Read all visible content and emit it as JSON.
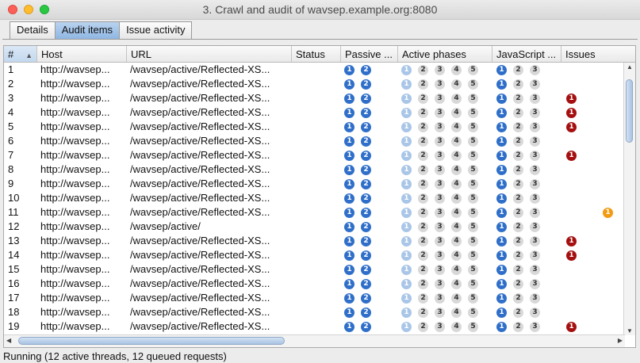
{
  "window": {
    "title": "3. Crawl and audit of wavsep.example.org:8080"
  },
  "tabs": [
    {
      "label": "Details",
      "active": false
    },
    {
      "label": "Audit items",
      "active": true
    },
    {
      "label": "Issue activity",
      "active": false
    }
  ],
  "columns": {
    "num": "#",
    "host": "Host",
    "url": "URL",
    "status": "Status",
    "passive": "Passive ...",
    "active": "Active phases",
    "js": "JavaScript ...",
    "issues": "Issues"
  },
  "phase_labels": {
    "passive": [
      "1",
      "2"
    ],
    "active": [
      "1",
      "2",
      "3",
      "4",
      "5"
    ],
    "js": [
      "1",
      "2",
      "3"
    ]
  },
  "colors": {
    "complete_blue": "#2f6fc9",
    "light_blue": "#a9c6e8",
    "pending_gray": "#d8d8d8",
    "issue_high_red": "#a50f0f",
    "issue_medium_orange": "#f29a12"
  },
  "rows": [
    {
      "num": "1",
      "host": "http://wavsep...",
      "url": "/wavsep/active/Reflected-XS...",
      "status": "",
      "passive_done": 2,
      "active_done": 1,
      "js_done": 1,
      "issue_high": "",
      "issue_medium": ""
    },
    {
      "num": "2",
      "host": "http://wavsep...",
      "url": "/wavsep/active/Reflected-XS...",
      "status": "",
      "passive_done": 2,
      "active_done": 1,
      "js_done": 1,
      "issue_high": "",
      "issue_medium": ""
    },
    {
      "num": "3",
      "host": "http://wavsep...",
      "url": "/wavsep/active/Reflected-XS...",
      "status": "",
      "passive_done": 2,
      "active_done": 1,
      "js_done": 1,
      "issue_high": "1",
      "issue_medium": ""
    },
    {
      "num": "4",
      "host": "http://wavsep...",
      "url": "/wavsep/active/Reflected-XS...",
      "status": "",
      "passive_done": 2,
      "active_done": 1,
      "js_done": 1,
      "issue_high": "1",
      "issue_medium": ""
    },
    {
      "num": "5",
      "host": "http://wavsep...",
      "url": "/wavsep/active/Reflected-XS...",
      "status": "",
      "passive_done": 2,
      "active_done": 1,
      "js_done": 1,
      "issue_high": "1",
      "issue_medium": ""
    },
    {
      "num": "6",
      "host": "http://wavsep...",
      "url": "/wavsep/active/Reflected-XS...",
      "status": "",
      "passive_done": 2,
      "active_done": 1,
      "js_done": 1,
      "issue_high": "",
      "issue_medium": ""
    },
    {
      "num": "7",
      "host": "http://wavsep...",
      "url": "/wavsep/active/Reflected-XS...",
      "status": "",
      "passive_done": 2,
      "active_done": 1,
      "js_done": 1,
      "issue_high": "1",
      "issue_medium": ""
    },
    {
      "num": "8",
      "host": "http://wavsep...",
      "url": "/wavsep/active/Reflected-XS...",
      "status": "",
      "passive_done": 2,
      "active_done": 1,
      "js_done": 1,
      "issue_high": "",
      "issue_medium": ""
    },
    {
      "num": "9",
      "host": "http://wavsep...",
      "url": "/wavsep/active/Reflected-XS...",
      "status": "",
      "passive_done": 2,
      "active_done": 1,
      "js_done": 1,
      "issue_high": "",
      "issue_medium": ""
    },
    {
      "num": "10",
      "host": "http://wavsep...",
      "url": "/wavsep/active/Reflected-XS...",
      "status": "",
      "passive_done": 2,
      "active_done": 1,
      "js_done": 1,
      "issue_high": "",
      "issue_medium": ""
    },
    {
      "num": "11",
      "host": "http://wavsep...",
      "url": "/wavsep/active/Reflected-XS...",
      "status": "",
      "passive_done": 2,
      "active_done": 1,
      "js_done": 1,
      "issue_high": "",
      "issue_medium": "1"
    },
    {
      "num": "12",
      "host": "http://wavsep...",
      "url": "/wavsep/active/",
      "status": "",
      "passive_done": 2,
      "active_done": 1,
      "js_done": 1,
      "issue_high": "",
      "issue_medium": ""
    },
    {
      "num": "13",
      "host": "http://wavsep...",
      "url": "/wavsep/active/Reflected-XS...",
      "status": "",
      "passive_done": 2,
      "active_done": 1,
      "js_done": 1,
      "issue_high": "1",
      "issue_medium": ""
    },
    {
      "num": "14",
      "host": "http://wavsep...",
      "url": "/wavsep/active/Reflected-XS...",
      "status": "",
      "passive_done": 2,
      "active_done": 1,
      "js_done": 1,
      "issue_high": "1",
      "issue_medium": ""
    },
    {
      "num": "15",
      "host": "http://wavsep...",
      "url": "/wavsep/active/Reflected-XS...",
      "status": "",
      "passive_done": 2,
      "active_done": 1,
      "js_done": 1,
      "issue_high": "",
      "issue_medium": ""
    },
    {
      "num": "16",
      "host": "http://wavsep...",
      "url": "/wavsep/active/Reflected-XS...",
      "status": "",
      "passive_done": 2,
      "active_done": 1,
      "js_done": 1,
      "issue_high": "",
      "issue_medium": ""
    },
    {
      "num": "17",
      "host": "http://wavsep...",
      "url": "/wavsep/active/Reflected-XS...",
      "status": "",
      "passive_done": 2,
      "active_done": 1,
      "js_done": 1,
      "issue_high": "",
      "issue_medium": ""
    },
    {
      "num": "18",
      "host": "http://wavsep...",
      "url": "/wavsep/active/Reflected-XS...",
      "status": "",
      "passive_done": 2,
      "active_done": 1,
      "js_done": 1,
      "issue_high": "",
      "issue_medium": ""
    },
    {
      "num": "19",
      "host": "http://wavsep...",
      "url": "/wavsep/active/Reflected-XS...",
      "status": "",
      "passive_done": 2,
      "active_done": 1,
      "js_done": 1,
      "issue_high": "1",
      "issue_medium": ""
    }
  ],
  "status_bar": "Running (12 active threads, 12 queued requests)"
}
